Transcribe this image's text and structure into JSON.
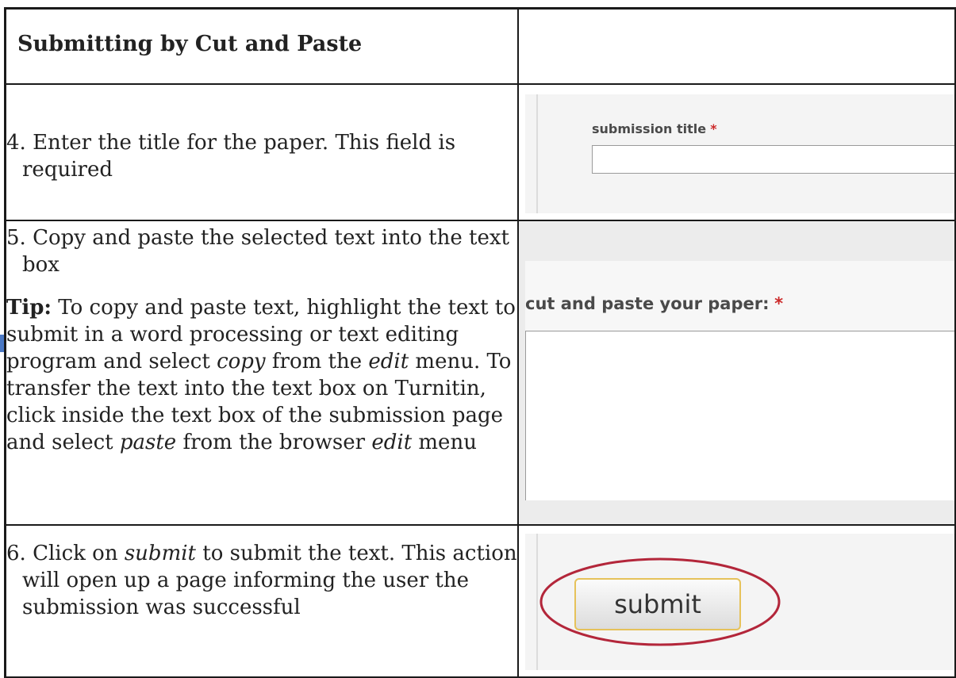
{
  "header": {
    "title": "Submitting by Cut and Paste"
  },
  "steps": [
    {
      "text": "4. Enter the title for the paper. This field is required",
      "panel": {
        "label": "submission title",
        "required_mark": "*"
      }
    },
    {
      "text": "5. Copy and paste the selected text into the text box",
      "tip_label": "Tip:",
      "tip_parts": [
        " To copy and paste text, highlight the text to submit in a word processing or text editing program and select ",
        "copy",
        " from the ",
        "edit",
        " menu.  To transfer the text into the text box on Turnitin, click inside the text box of the submission page and select ",
        "paste",
        " from the browser ",
        "edit",
        " menu"
      ],
      "panel": {
        "label": "cut and paste your paper:",
        "required_mark": "*"
      }
    },
    {
      "text_parts": [
        "6. Click on ",
        "submit",
        " to submit the text. This action will open up a page informing the user the submission was successful"
      ],
      "panel": {
        "button_label": "submit",
        "highlight_color": "#b3263a"
      }
    }
  ]
}
